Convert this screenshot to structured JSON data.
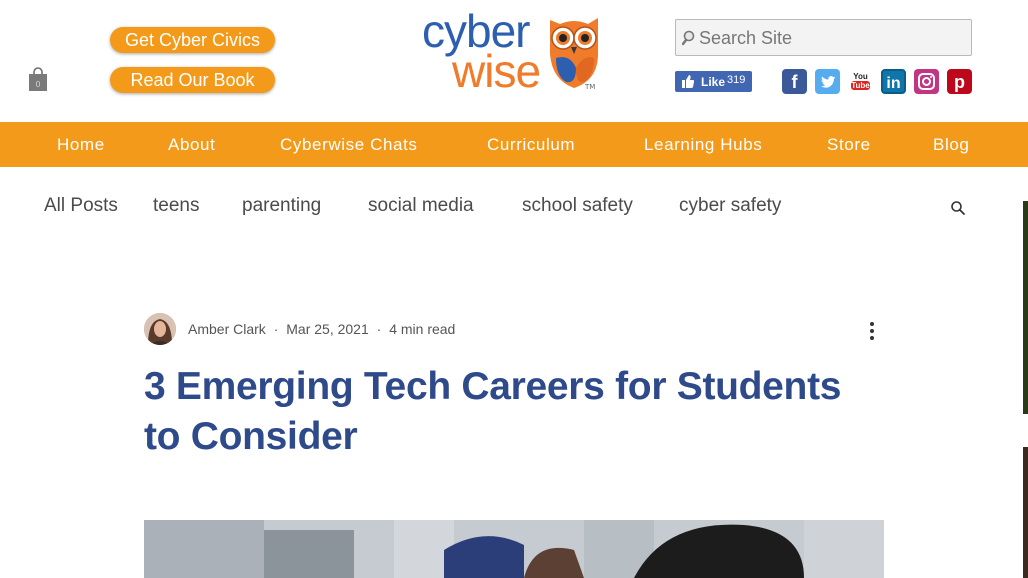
{
  "header": {
    "cart_count": "0",
    "buttons": {
      "civics": "Get Cyber Civics",
      "book": "Read Our Book"
    },
    "logo": {
      "line1": "cyber",
      "line2": "wise",
      "tm": "TM"
    },
    "search": {
      "placeholder": "Search Site"
    },
    "facebook_like": {
      "label": "Like",
      "count": "319"
    },
    "social": [
      {
        "icon": "facebook-icon",
        "glyph": "f"
      },
      {
        "icon": "twitter-icon",
        "glyph": ""
      },
      {
        "icon": "youtube-icon",
        "glyph": "You\nTube"
      },
      {
        "icon": "linkedin-icon",
        "glyph": "in"
      },
      {
        "icon": "instagram-icon",
        "glyph": ""
      },
      {
        "icon": "pinterest-icon",
        "glyph": "p"
      }
    ]
  },
  "nav": {
    "items": [
      "Home",
      "About",
      "Cyberwise Chats",
      "Curriculum",
      "Learning Hubs",
      "Store",
      "Blog"
    ]
  },
  "categories": {
    "items": [
      "All Posts",
      "teens",
      "parenting",
      "social media",
      "school safety",
      "cyber safety"
    ]
  },
  "post": {
    "author": "Amber Clark",
    "separator": "·",
    "date": "Mar 25, 2021",
    "read_time": "4 min read",
    "title": "3 Emerging Tech Careers for Students to Consider"
  },
  "colors": {
    "accent": "#f39a1a",
    "title": "#2f4a8a",
    "logo_blue": "#2d5fb0",
    "logo_orange": "#f07b2a"
  }
}
